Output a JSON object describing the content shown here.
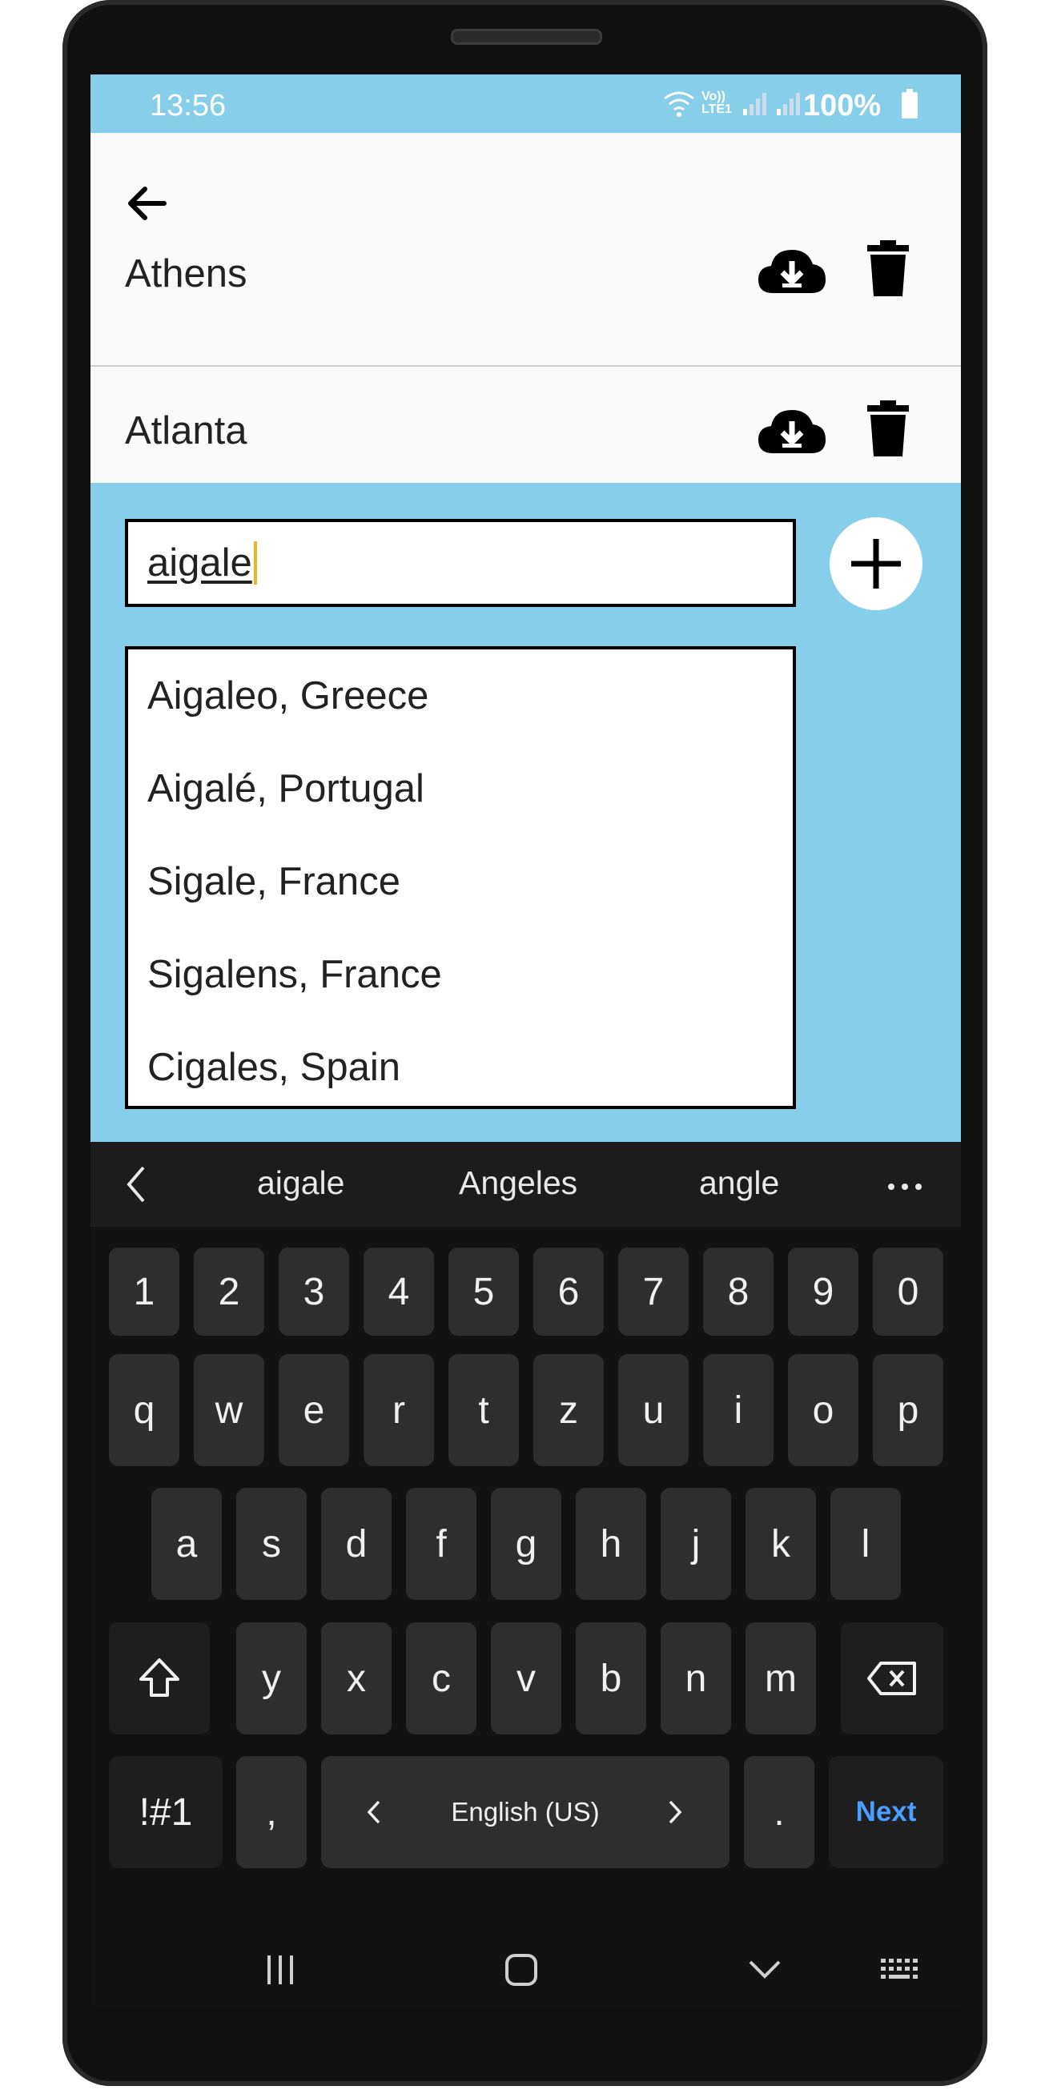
{
  "status_bar": {
    "time": "13:56",
    "network": "Vo)) LTE1",
    "battery": "100%"
  },
  "list": {
    "items": [
      {
        "label": "Athens"
      },
      {
        "label": "Atlanta"
      }
    ]
  },
  "search": {
    "value": "aigale"
  },
  "suggestions": [
    "Aigaleo, Greece",
    "Aigalé, Portugal",
    "Sigale, France",
    "Sigalens, France",
    "Cigales, Spain"
  ],
  "keyboard": {
    "suggestion_words": [
      "aigale",
      "Angeles",
      "angle"
    ],
    "number_row": [
      "1",
      "2",
      "3",
      "4",
      "5",
      "6",
      "7",
      "8",
      "9",
      "0"
    ],
    "row1": [
      "q",
      "w",
      "e",
      "r",
      "t",
      "z",
      "u",
      "i",
      "o",
      "p"
    ],
    "row2": [
      "a",
      "s",
      "d",
      "f",
      "g",
      "h",
      "j",
      "k",
      "l"
    ],
    "row3": [
      "y",
      "x",
      "c",
      "v",
      "b",
      "n",
      "m"
    ],
    "symbols_label": "!#1",
    "comma_label": ",",
    "language_label": "English (US)",
    "period_label": ".",
    "next_label": "Next"
  },
  "colors": {
    "accent": "#87ceeb",
    "next_key_text": "#4a9eff",
    "caret": "#f0b429"
  }
}
